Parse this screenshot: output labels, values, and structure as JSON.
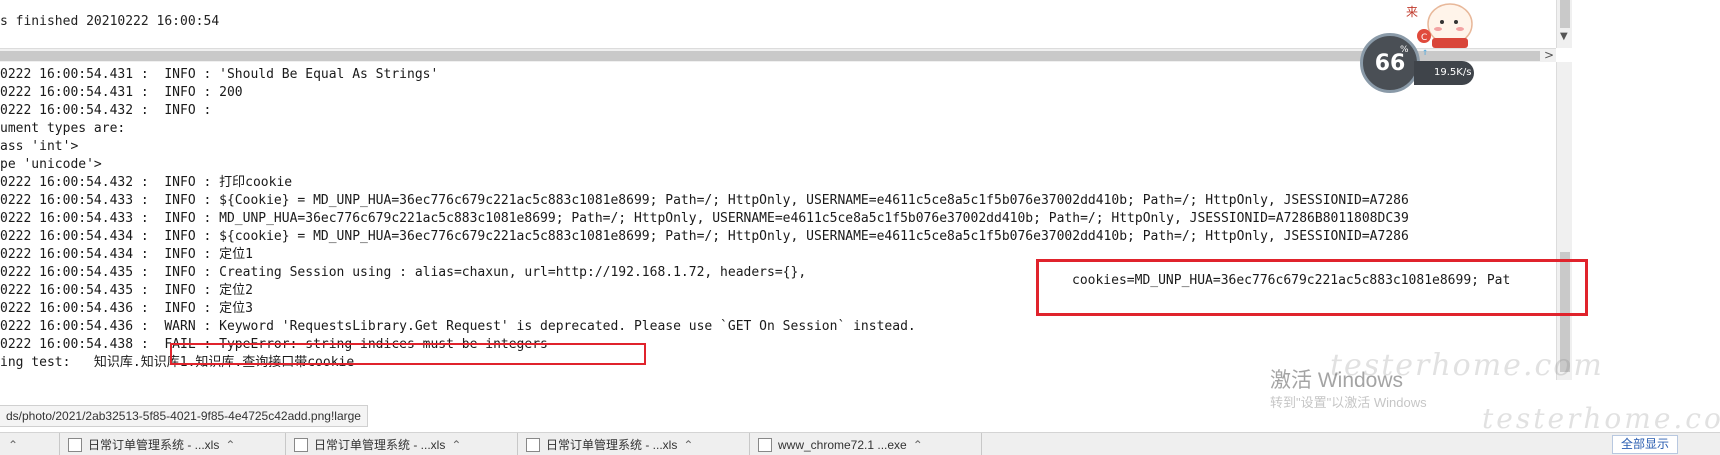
{
  "top_line": "s finished 20210222 16:00:54",
  "log_lines": [
    "0222 16:00:54.431 :  INFO : 'Should Be Equal As Strings'",
    "0222 16:00:54.431 :  INFO : 200",
    "0222 16:00:54.432 :  INFO :",
    "ument types are:",
    "ass 'int'>",
    "pe 'unicode'>",
    "0222 16:00:54.432 :  INFO : 打印cookie",
    "0222 16:00:54.433 :  INFO : ${Cookie} = MD_UNP_HUA=36ec776c679c221ac5c883c1081e8699; Path=/; HttpOnly, USERNAME=e4611c5ce8a5c1f5b076e37002dd410b; Path=/; HttpOnly, JSESSIONID=A7286",
    "0222 16:00:54.433 :  INFO : MD_UNP_HUA=36ec776c679c221ac5c883c1081e8699; Path=/; HttpOnly, USERNAME=e4611c5ce8a5c1f5b076e37002dd410b; Path=/; HttpOnly, JSESSIONID=A7286B8011808DC39",
    "0222 16:00:54.434 :  INFO : ${cookie} = MD_UNP_HUA=36ec776c679c221ac5c883c1081e8699; Path=/; HttpOnly, USERNAME=e4611c5ce8a5c1f5b076e37002dd410b; Path=/; HttpOnly, JSESSIONID=A7286",
    "0222 16:00:54.434 :  INFO : 定位1",
    "0222 16:00:54.435 :  INFO : Creating Session using : alias=chaxun, url=http://192.168.1.72, headers={},",
    "0222 16:00:54.435 :  INFO : 定位2",
    "0222 16:00:54.436 :  INFO : 定位3",
    "0222 16:00:54.436 :  WARN : Keyword 'RequestsLibrary.Get Request' is deprecated. Please use `GET On Session` instead.",
    "0222 16:00:54.438 :  FAIL : TypeError: string indices must be integers",
    "ing test:   知识库.知识库1.知识库.查询接口带cookie"
  ],
  "cookie_overlay": "cookies=MD_UNP_HUA=36ec776c679c221ac5c883c1081e8699; Pat",
  "url_bar": "ds/photo/2021/2ab32513-5f85-4021-9f85-4e4725c42add.png!large",
  "taskbar": {
    "tabs": [
      {
        "label": "日常订单管理系统 - ...xls"
      },
      {
        "label": "日常订单管理系统 - ...xls"
      },
      {
        "label": "日常订单管理系统 - ...xls"
      },
      {
        "label": "www_chrome72.1 ...exe"
      }
    ],
    "right_button": "全部显示"
  },
  "speed_widget": {
    "percent": "66",
    "percent_unit": "%",
    "speed": "19.5K/s"
  },
  "watermarks": {
    "windows_activate": "激活 Windows",
    "windows_activate_sub": "转到\"设置\"以激活 Windows",
    "site1": "testerhome.com",
    "site2": "testerhome.com"
  },
  "colors": {
    "annotation_red": "#e0232c",
    "log_text": "#1a1a1a"
  }
}
